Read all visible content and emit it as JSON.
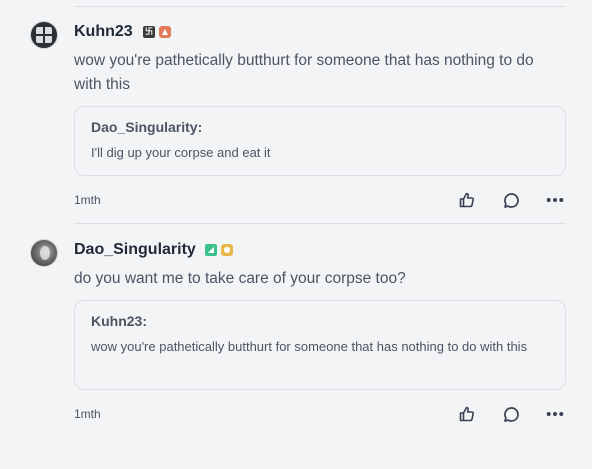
{
  "comments": [
    {
      "username": "Kuhn23",
      "badges": [
        "kh-badge-icon",
        "flame-badge-icon"
      ],
      "text": "wow you're pathetically butthurt for someone that has nothing to do with this",
      "quote": {
        "author": "Dao_Singularity:",
        "text": "I'll dig up your corpse and eat it"
      },
      "time": "1mth"
    },
    {
      "username": "Dao_Singularity",
      "badges": [
        "green-badge-icon",
        "gold-badge-icon"
      ],
      "text": "do you want me to take care of your corpse too?",
      "quote": {
        "author": "Kuhn23:",
        "text": "wow you're pathetically butthurt for someone that has nothing to do with this"
      },
      "time": "1mth"
    }
  ],
  "icons": {
    "like": "thumbs-up-icon",
    "reply": "comment-bubble-icon",
    "more": "more-dots-icon"
  }
}
